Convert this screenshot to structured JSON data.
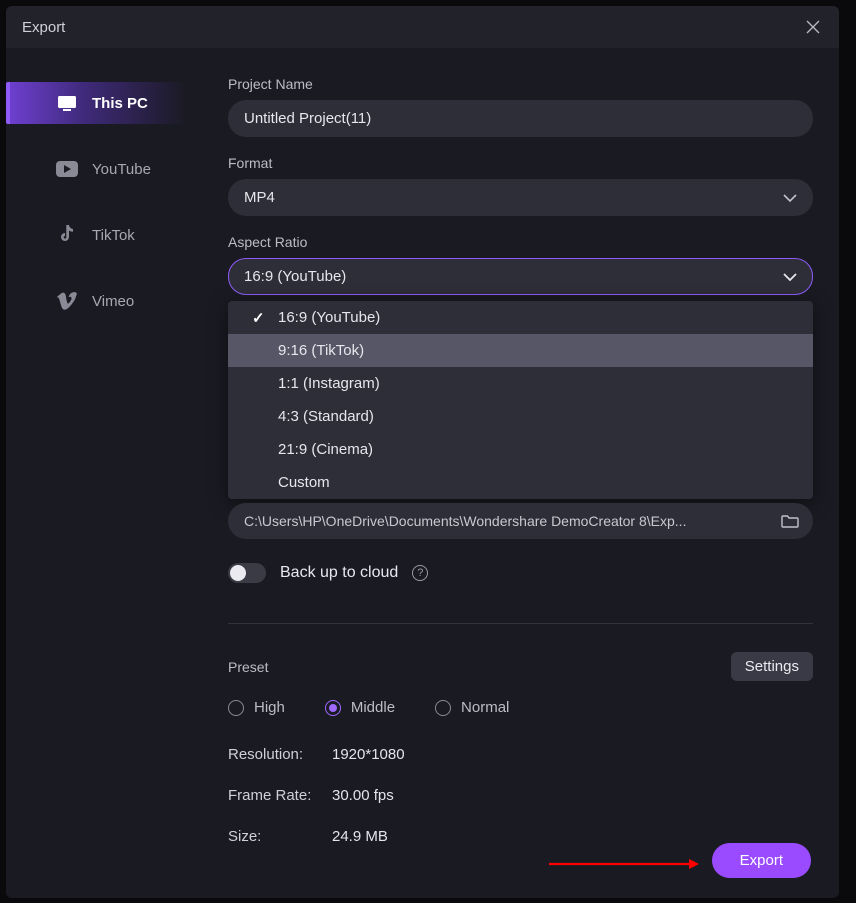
{
  "titlebar": {
    "title": "Export"
  },
  "sidebar": {
    "items": [
      {
        "label": "This PC"
      },
      {
        "label": "YouTube"
      },
      {
        "label": "TikTok"
      },
      {
        "label": "Vimeo"
      }
    ]
  },
  "fields": {
    "project_name_label": "Project Name",
    "project_name_value": "Untitled Project(11)",
    "format_label": "Format",
    "format_value": "MP4",
    "aspect_label": "Aspect Ratio",
    "aspect_value": "16:9 (YouTube)",
    "aspect_options": [
      "16:9 (YouTube)",
      "9:16 (TikTok)",
      "1:1 (Instagram)",
      "4:3 (Standard)",
      "21:9 (Cinema)",
      "Custom"
    ],
    "path_value": "C:\\Users\\HP\\OneDrive\\Documents\\Wondershare DemoCreator 8\\Exp...",
    "backup_label": "Back up to cloud"
  },
  "preset": {
    "label": "Preset",
    "settings_label": "Settings",
    "options": {
      "high": "High",
      "middle": "Middle",
      "normal": "Normal"
    },
    "selected": "middle",
    "resolution_k": "Resolution:",
    "resolution_v": "1920*1080",
    "framerate_k": "Frame Rate:",
    "framerate_v": "30.00 fps",
    "size_k": "Size:",
    "size_v": "24.9 MB"
  },
  "export_button": "Export"
}
